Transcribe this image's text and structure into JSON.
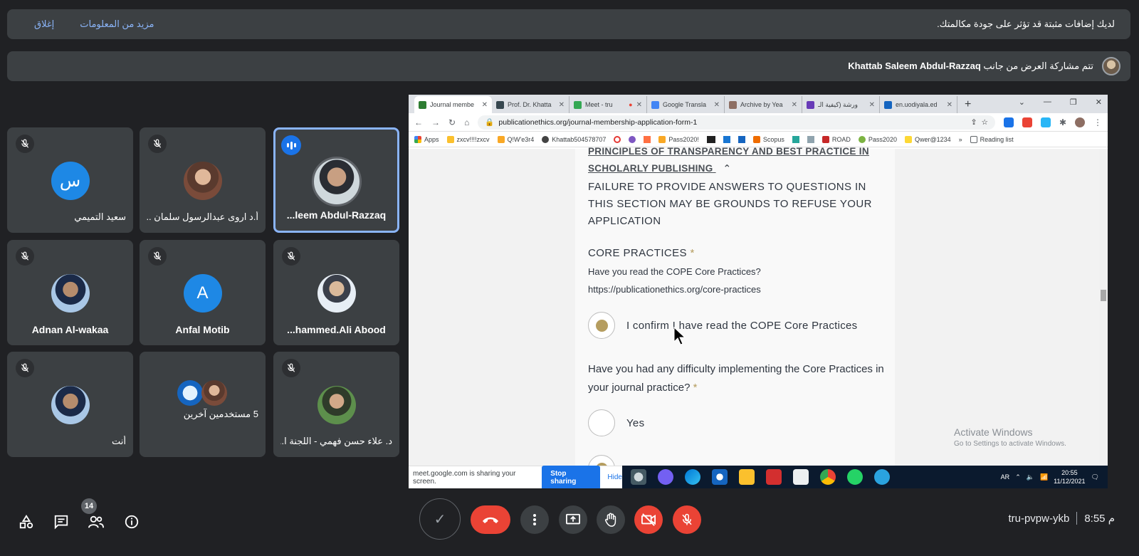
{
  "notifications": {
    "extensions_message": "لديك إضافات مثبتة قد تؤثر على جودة مكالمتك.",
    "more_info": "مزيد من المعلومات",
    "close": "إغلاق",
    "presenting_prefix": "تتم مشاركة العرض من جانب",
    "presenter_name": "Khattab Saleem Abdul-Razzaq"
  },
  "participants": [
    {
      "name": "...leem Abdul-Razzaq",
      "initial": "",
      "avatar": "photo",
      "speaking": true
    },
    {
      "name": "أ.د اروى عبدالرسول سلمان ...",
      "initial": "",
      "avatar": "photo",
      "muted": true
    },
    {
      "name": "سعيد التميمي",
      "initial": "س",
      "avatar": "letter",
      "color": "#1e88e5",
      "muted": true
    },
    {
      "name": "...hammed.Ali Abood",
      "initial": "",
      "avatar": "photo",
      "muted": true
    },
    {
      "name": "Anfal Motib",
      "initial": "A",
      "avatar": "letter",
      "color": "#1e88e5",
      "muted": true
    },
    {
      "name": "Adnan Al-wakaa",
      "initial": "",
      "avatar": "photo",
      "muted": true
    },
    {
      "name": "د. علاء حسن فهمي - اللجنة ا...",
      "initial": "",
      "avatar": "photo",
      "muted": true
    },
    {
      "name": "5 مستخدمين آخرين",
      "initial": "",
      "avatar": "group"
    },
    {
      "name": "أنت",
      "initial": "",
      "avatar": "photo",
      "muted": true
    }
  ],
  "browser": {
    "tabs": [
      {
        "title": "Journal membe",
        "color": "#2e7d32"
      },
      {
        "title": "Prof. Dr. Khatta",
        "color": "#37474f"
      },
      {
        "title": "Meet - tru",
        "color": "#34a853"
      },
      {
        "title": "Google Transla",
        "color": "#4285f4"
      },
      {
        "title": "Archive by Yea",
        "color": "#8d6e63"
      },
      {
        "title": "ورشة (كيفية الـ",
        "color": "#673ab7"
      },
      {
        "title": "en.uodiyala.ed",
        "color": "#1565c0"
      }
    ],
    "url": "publicationethics.org/journal-membership-application-form-1",
    "bookmarks": [
      "Apps",
      "zxcv!!!!zxcv",
      "Q!W'e3r4",
      "Khattab504578707",
      "Pass2020!",
      "Scopus",
      "ROAD",
      "Pass2020",
      "Qwer@1234",
      "Reading list"
    ]
  },
  "form": {
    "section_heading": "PRINCIPLES OF TRANSPARENCY AND BEST PRACTICE IN SCHOLARLY PUBLISHING",
    "warning": "FAILURE TO PROVIDE ANSWERS TO QUESTIONS IN THIS SECTION MAY BE GROUNDS TO REFUSE YOUR APPLICATION",
    "core_practices_label": "CORE PRACTICES",
    "required_mark": "*",
    "question1": "Have you read the COPE Core Practices?",
    "question1_url": "https://publicationethics.org/core-practices",
    "confirm_option": "I confirm I have read the COPE Core Practices",
    "question2": "Have you had any difficulty implementing the Core Practices in your journal practice?",
    "option_yes": "Yes"
  },
  "windows": {
    "activate_title": "Activate Windows",
    "activate_sub": "Go to Settings to activate Windows.",
    "sharing_text": "meet.google.com is sharing your screen.",
    "stop_sharing": "Stop sharing",
    "hide": "Hide",
    "lang": "AR",
    "time": "20:55",
    "date": "11/12/2021"
  },
  "meeting": {
    "code": "tru-pvpw-ykb",
    "time": "8:55 م",
    "people_count": "14"
  },
  "colors": {
    "end_call": "#ea4335",
    "accent": "#8ab4f8"
  }
}
